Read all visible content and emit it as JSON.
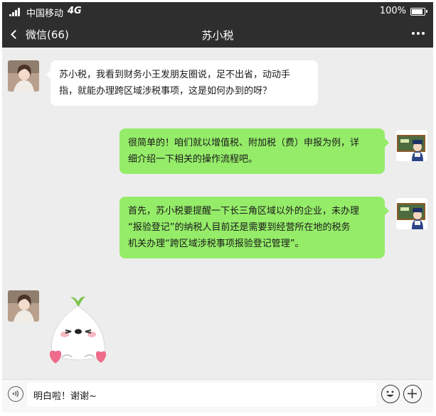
{
  "status_bar": {
    "carrier": "中国移动",
    "network": "4G",
    "battery_percent": "100%",
    "battery_level": 1.0
  },
  "nav": {
    "back_label": "微信(66)",
    "title": "苏小税"
  },
  "messages": [
    {
      "from": "user",
      "text_lines": [
        "苏小税，我看到财务小王发朋友圈说，足不出省，动动手",
        "指，就能办理跨区域涉税事项，这是如何办到的呀？"
      ]
    },
    {
      "from": "assistant",
      "text_lines": [
        "很简单的！咱们就以增值税、附加税（费）申报为例，详",
        "细介绍一下相关的操作流程吧。"
      ]
    },
    {
      "from": "assistant",
      "text_lines": [
        "首先，苏小税要提醒一下长三角区域以外的企业，未办理",
        "“报验登记”的纳税人目前还是需要到经营所在地的税务",
        "机关办理“跨区域涉税事项报验登记管理”。"
      ]
    },
    {
      "from": "user",
      "type": "sticker"
    }
  ],
  "input": {
    "value": "明白啦！谢谢~"
  },
  "colors": {
    "bar_bg": "#2e2e2e",
    "chat_bg": "#ededed",
    "outgoing_bubble": "#95ec69",
    "incoming_bubble": "#ffffff"
  }
}
